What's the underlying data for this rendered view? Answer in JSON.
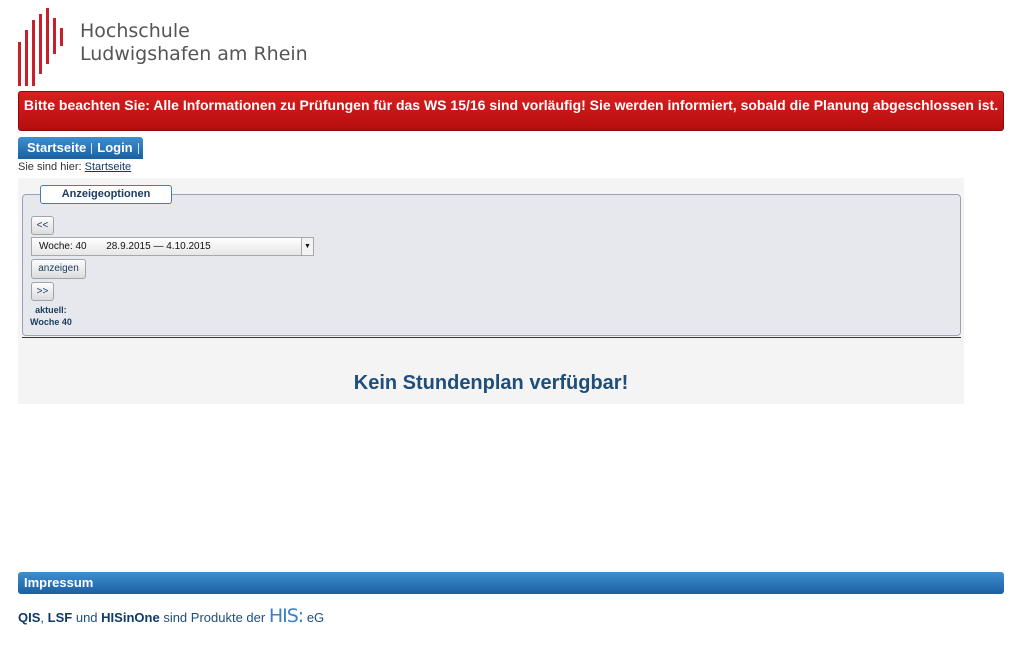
{
  "institution": {
    "line1": "Hochschule",
    "line2": "Ludwigshafen am Rhein"
  },
  "alert": {
    "text": "Bitte beachten Sie: Alle Informationen zu Prüfungen für das WS 15/16 sind vorläufig! Sie werden informiert, sobald die Planung abgeschlossen ist."
  },
  "nav": {
    "items": [
      {
        "label": "Startseite"
      },
      {
        "label": "Login"
      }
    ]
  },
  "breadcrumb": {
    "prefix": "Sie sind hier:",
    "link": "Startseite"
  },
  "options": {
    "legend": "Anzeigeoptionen",
    "prev_label": "<<",
    "week_select": {
      "week": "Woche: 40",
      "range": "28.9.2015 — 4.10.2015"
    },
    "show_label": "anzeigen",
    "next_label": ">>",
    "current_label": "aktuell:",
    "current_week": "Woche 40"
  },
  "message": "Kein Stundenplan verfügbar!",
  "footer": {
    "impressum": "Impressum",
    "products": {
      "qis": "QIS",
      "comma": ",",
      "lsf": "LSF",
      "und": "und",
      "hisinone": "HISinOne",
      "rest": "sind Produkte der",
      "his": "HIS:",
      "eg": "eG"
    }
  },
  "colors": {
    "alert_red": "#c01414",
    "nav_blue": "#2a73b8",
    "text_blue": "#1e4f7a",
    "logo_red": "#c8202a"
  }
}
